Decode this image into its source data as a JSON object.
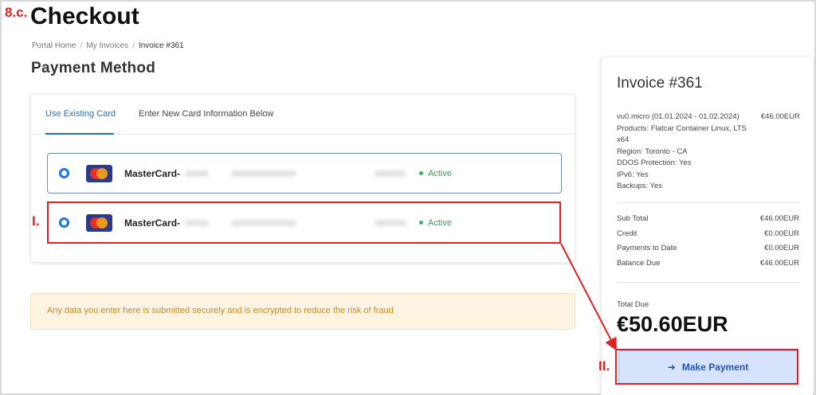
{
  "annotation": {
    "step": "8.c.",
    "label_1": "I.",
    "label_2": "II."
  },
  "page": {
    "title": "Checkout",
    "breadcrumb": [
      "Portal Home",
      "My Invoices",
      "Invoice #361"
    ],
    "breadcrumb_sep": "/",
    "section_title": "Payment Method"
  },
  "tabs": [
    {
      "label": "Use Existing Card",
      "active": true
    },
    {
      "label": "Enter New Card Information Below",
      "active": false
    }
  ],
  "cards": [
    {
      "name": "MasterCard-",
      "icon": "mastercard-icon",
      "status": "Active",
      "selected": true
    },
    {
      "name": "MasterCard-",
      "icon": "mastercard-icon",
      "status": "Active",
      "selected": true
    }
  ],
  "notice": "Any data you enter here is submitted securely and is encrypted to reduce the risk of fraud",
  "invoice": {
    "title": "Invoice #361",
    "item_lines": [
      "vu0.micro (01.01.2024 - 01.02.2024)",
      "Products: Flatcar Container Linux, LTS x64",
      "Region: Toronto - CA",
      "DDOS Protection: Yes",
      "IPv6: Yes",
      "Backups: Yes"
    ],
    "item_price": "€46.00EUR",
    "totals": [
      {
        "label": "Sub Total",
        "value": "€46.00EUR"
      },
      {
        "label": "Credit",
        "value": "€0.00EUR"
      },
      {
        "label": "Payments to Date",
        "value": "€0.00EUR"
      },
      {
        "label": "Balance Due",
        "value": "€46.00EUR"
      }
    ],
    "total_due_label": "Total Due",
    "total_due_value": "€50.60EUR",
    "pay_button": "Make Payment",
    "pay_icon": "arrow-right-icon"
  },
  "colors": {
    "accent": "#2a6ebb",
    "annotation": "#e02020",
    "status_active": "#3b9c4f",
    "notice_bg": "#fdf3e1"
  }
}
